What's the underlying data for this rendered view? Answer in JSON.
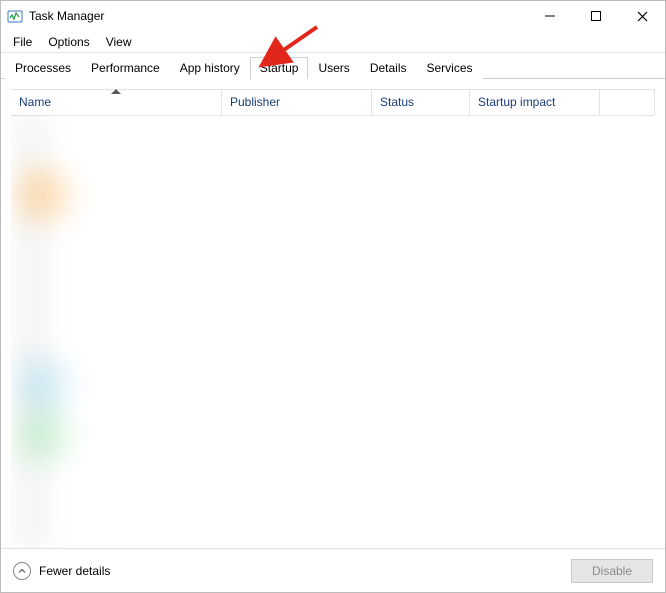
{
  "window": {
    "title": "Task Manager"
  },
  "menu": {
    "file": "File",
    "options": "Options",
    "view": "View"
  },
  "tabs": {
    "processes": "Processes",
    "performance": "Performance",
    "app_history": "App history",
    "startup": "Startup",
    "users": "Users",
    "details": "Details",
    "services": "Services",
    "active": "startup"
  },
  "columns": {
    "name": "Name",
    "publisher": "Publisher",
    "status": "Status",
    "impact": "Startup impact",
    "sorted_by": "name",
    "sort_dir": "asc"
  },
  "footer": {
    "fewer": "Fewer details",
    "disable": "Disable",
    "disable_enabled": false
  },
  "icons": {
    "app": "task-manager-icon",
    "minimize": "minimize-icon",
    "maximize": "maximize-icon",
    "close": "close-icon",
    "chevron_up": "chevron-up-icon"
  },
  "annotation": {
    "arrow_points_to": "tab-startup"
  }
}
